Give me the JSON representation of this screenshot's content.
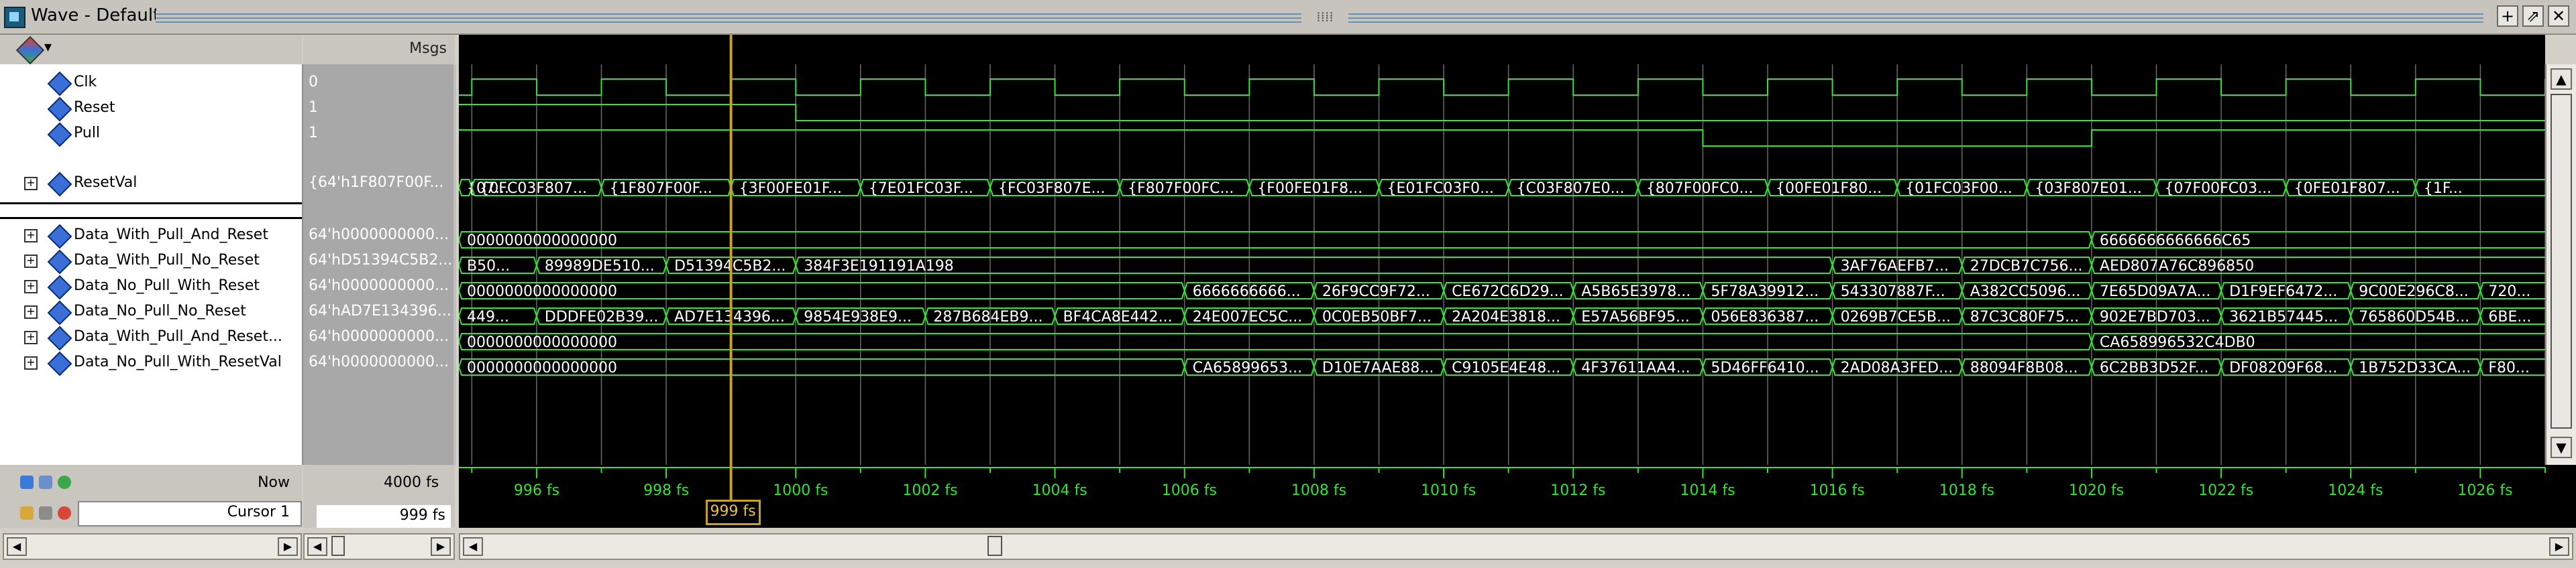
{
  "window": {
    "title": "Wave - Default",
    "controls": [
      "+",
      "⇗",
      "✕"
    ]
  },
  "panes": {
    "msgs_label": "Msgs"
  },
  "signals": [
    {
      "name": "Clk",
      "value": "0",
      "expandable": false
    },
    {
      "name": "Reset",
      "value": "1",
      "expandable": false
    },
    {
      "name": "Pull",
      "value": "1",
      "expandable": false
    },
    {
      "name": "ResetVal",
      "value": "{64'h1F807F00F...",
      "expandable": true
    },
    {
      "name": "Data_With_Pull_And_Reset",
      "value": "64'h0000000000...",
      "expandable": true
    },
    {
      "name": "Data_With_Pull_No_Reset",
      "value": "64'hD51394C5B2...",
      "expandable": true
    },
    {
      "name": "Data_No_Pull_With_Reset",
      "value": "64'h0000000000...",
      "expandable": true
    },
    {
      "name": "Data_No_Pull_No_Reset",
      "value": "64'hAD7E134396...",
      "expandable": true
    },
    {
      "name": "Data_With_Pull_And_Reset...",
      "value": "64'h0000000000...",
      "expandable": true
    },
    {
      "name": "Data_No_Pull_With_ResetVal",
      "value": "64'h0000000000...",
      "expandable": true
    }
  ],
  "buses": {
    "ResetVal": [
      "{07...",
      "{0FC03F807...",
      "{1F807F00F...",
      "{3F00FE01F...",
      "{7E01FC03F...",
      "{FC03F807E...",
      "{F807F00FC...",
      "{F00FE01F8...",
      "{E01FC03F0...",
      "{C03F807E0...",
      "{807F00FC0...",
      "{00FE01F80...",
      "{01FC03F00...",
      "{03F807E01...",
      "{07F00FC03...",
      "{0FE01F807...",
      "{1F..."
    ],
    "Data_With_Pull_And_Reset": [
      "0000000000000000",
      "6666666666666C65"
    ],
    "Data_With_Pull_No_Reset": [
      "B50...",
      "89989DE510...",
      "D51394C5B2...",
      "384F3E191191A198",
      "3AF76AEFB7...",
      "27DCB7C756...",
      "AED807A76C896850"
    ],
    "Data_No_Pull_With_Reset": [
      "0000000000000000",
      "6666666666...",
      "26F9CC9F72...",
      "CE672C6D29...",
      "A5B65E3978...",
      "5F78A39912...",
      "543307887F...",
      "A382CC5096...",
      "7E65D09A7A...",
      "D1F9EF6472...",
      "9C00E296C8...",
      "720..."
    ],
    "Data_No_Pull_No_Reset": [
      "449...",
      "DDDFE02B39...",
      "AD7E134396...",
      "9854E938E9...",
      "287B684EB9...",
      "BF4CA8E442...",
      "24E007EC5C...",
      "0C0EB50BF7...",
      "2A204E3818...",
      "E57A56BF95...",
      "056E836387...",
      "0269B7CE5B...",
      "87C3C80F75...",
      "902E7BD703...",
      "3621B57445...",
      "765860D54B...",
      "6BE..."
    ],
    "Data_With_Pull_And_Reset2": [
      "0000000000000000",
      "CA658996532C4DB0"
    ],
    "Data_No_Pull_With_ResetVal": [
      "0000000000000000",
      "CA65899653...",
      "D10E7AAE88...",
      "C9105E4E48...",
      "4F37611AA4...",
      "5D46FF6410...",
      "2AD08A3FED...",
      "88094F8B08...",
      "6C2BB3D52F...",
      "DF08209F68...",
      "1B752D33CA...",
      "F80..."
    ]
  },
  "timeline": {
    "labels": [
      "996 fs",
      "998 fs",
      "1000 fs",
      "1002 fs",
      "1004 fs",
      "1006 fs",
      "1008 fs",
      "1010 fs",
      "1012 fs",
      "1014 fs",
      "1016 fs",
      "1018 fs",
      "1020 fs",
      "1022 fs",
      "1024 fs",
      "1026 fs"
    ],
    "now_label": "Now",
    "now_value": "4000 fs",
    "cursor_label": "Cursor 1",
    "cursor_value": "999 fs",
    "cursor_tag": "999 fs"
  },
  "colors": {
    "wave_green": "#31e531",
    "cursor": "#c8a02e",
    "bus_text": "#ffffff",
    "background": "#000000"
  }
}
